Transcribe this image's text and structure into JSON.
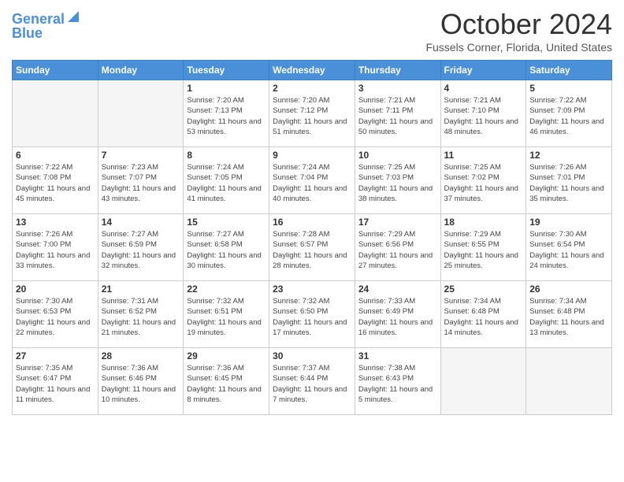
{
  "header": {
    "logo_line1": "General",
    "logo_line2": "Blue",
    "month_title": "October 2024",
    "location": "Fussels Corner, Florida, United States"
  },
  "days_of_week": [
    "Sunday",
    "Monday",
    "Tuesday",
    "Wednesday",
    "Thursday",
    "Friday",
    "Saturday"
  ],
  "weeks": [
    [
      {
        "day": "",
        "sunrise": "",
        "sunset": "",
        "daylight": ""
      },
      {
        "day": "",
        "sunrise": "",
        "sunset": "",
        "daylight": ""
      },
      {
        "day": "1",
        "sunrise": "Sunrise: 7:20 AM",
        "sunset": "Sunset: 7:13 PM",
        "daylight": "Daylight: 11 hours and 53 minutes."
      },
      {
        "day": "2",
        "sunrise": "Sunrise: 7:20 AM",
        "sunset": "Sunset: 7:12 PM",
        "daylight": "Daylight: 11 hours and 51 minutes."
      },
      {
        "day": "3",
        "sunrise": "Sunrise: 7:21 AM",
        "sunset": "Sunset: 7:11 PM",
        "daylight": "Daylight: 11 hours and 50 minutes."
      },
      {
        "day": "4",
        "sunrise": "Sunrise: 7:21 AM",
        "sunset": "Sunset: 7:10 PM",
        "daylight": "Daylight: 11 hours and 48 minutes."
      },
      {
        "day": "5",
        "sunrise": "Sunrise: 7:22 AM",
        "sunset": "Sunset: 7:09 PM",
        "daylight": "Daylight: 11 hours and 46 minutes."
      }
    ],
    [
      {
        "day": "6",
        "sunrise": "Sunrise: 7:22 AM",
        "sunset": "Sunset: 7:08 PM",
        "daylight": "Daylight: 11 hours and 45 minutes."
      },
      {
        "day": "7",
        "sunrise": "Sunrise: 7:23 AM",
        "sunset": "Sunset: 7:07 PM",
        "daylight": "Daylight: 11 hours and 43 minutes."
      },
      {
        "day": "8",
        "sunrise": "Sunrise: 7:24 AM",
        "sunset": "Sunset: 7:05 PM",
        "daylight": "Daylight: 11 hours and 41 minutes."
      },
      {
        "day": "9",
        "sunrise": "Sunrise: 7:24 AM",
        "sunset": "Sunset: 7:04 PM",
        "daylight": "Daylight: 11 hours and 40 minutes."
      },
      {
        "day": "10",
        "sunrise": "Sunrise: 7:25 AM",
        "sunset": "Sunset: 7:03 PM",
        "daylight": "Daylight: 11 hours and 38 minutes."
      },
      {
        "day": "11",
        "sunrise": "Sunrise: 7:25 AM",
        "sunset": "Sunset: 7:02 PM",
        "daylight": "Daylight: 11 hours and 37 minutes."
      },
      {
        "day": "12",
        "sunrise": "Sunrise: 7:26 AM",
        "sunset": "Sunset: 7:01 PM",
        "daylight": "Daylight: 11 hours and 35 minutes."
      }
    ],
    [
      {
        "day": "13",
        "sunrise": "Sunrise: 7:26 AM",
        "sunset": "Sunset: 7:00 PM",
        "daylight": "Daylight: 11 hours and 33 minutes."
      },
      {
        "day": "14",
        "sunrise": "Sunrise: 7:27 AM",
        "sunset": "Sunset: 6:59 PM",
        "daylight": "Daylight: 11 hours and 32 minutes."
      },
      {
        "day": "15",
        "sunrise": "Sunrise: 7:27 AM",
        "sunset": "Sunset: 6:58 PM",
        "daylight": "Daylight: 11 hours and 30 minutes."
      },
      {
        "day": "16",
        "sunrise": "Sunrise: 7:28 AM",
        "sunset": "Sunset: 6:57 PM",
        "daylight": "Daylight: 11 hours and 28 minutes."
      },
      {
        "day": "17",
        "sunrise": "Sunrise: 7:29 AM",
        "sunset": "Sunset: 6:56 PM",
        "daylight": "Daylight: 11 hours and 27 minutes."
      },
      {
        "day": "18",
        "sunrise": "Sunrise: 7:29 AM",
        "sunset": "Sunset: 6:55 PM",
        "daylight": "Daylight: 11 hours and 25 minutes."
      },
      {
        "day": "19",
        "sunrise": "Sunrise: 7:30 AM",
        "sunset": "Sunset: 6:54 PM",
        "daylight": "Daylight: 11 hours and 24 minutes."
      }
    ],
    [
      {
        "day": "20",
        "sunrise": "Sunrise: 7:30 AM",
        "sunset": "Sunset: 6:53 PM",
        "daylight": "Daylight: 11 hours and 22 minutes."
      },
      {
        "day": "21",
        "sunrise": "Sunrise: 7:31 AM",
        "sunset": "Sunset: 6:52 PM",
        "daylight": "Daylight: 11 hours and 21 minutes."
      },
      {
        "day": "22",
        "sunrise": "Sunrise: 7:32 AM",
        "sunset": "Sunset: 6:51 PM",
        "daylight": "Daylight: 11 hours and 19 minutes."
      },
      {
        "day": "23",
        "sunrise": "Sunrise: 7:32 AM",
        "sunset": "Sunset: 6:50 PM",
        "daylight": "Daylight: 11 hours and 17 minutes."
      },
      {
        "day": "24",
        "sunrise": "Sunrise: 7:33 AM",
        "sunset": "Sunset: 6:49 PM",
        "daylight": "Daylight: 11 hours and 16 minutes."
      },
      {
        "day": "25",
        "sunrise": "Sunrise: 7:34 AM",
        "sunset": "Sunset: 6:48 PM",
        "daylight": "Daylight: 11 hours and 14 minutes."
      },
      {
        "day": "26",
        "sunrise": "Sunrise: 7:34 AM",
        "sunset": "Sunset: 6:48 PM",
        "daylight": "Daylight: 11 hours and 13 minutes."
      }
    ],
    [
      {
        "day": "27",
        "sunrise": "Sunrise: 7:35 AM",
        "sunset": "Sunset: 6:47 PM",
        "daylight": "Daylight: 11 hours and 11 minutes."
      },
      {
        "day": "28",
        "sunrise": "Sunrise: 7:36 AM",
        "sunset": "Sunset: 6:46 PM",
        "daylight": "Daylight: 11 hours and 10 minutes."
      },
      {
        "day": "29",
        "sunrise": "Sunrise: 7:36 AM",
        "sunset": "Sunset: 6:45 PM",
        "daylight": "Daylight: 11 hours and 8 minutes."
      },
      {
        "day": "30",
        "sunrise": "Sunrise: 7:37 AM",
        "sunset": "Sunset: 6:44 PM",
        "daylight": "Daylight: 11 hours and 7 minutes."
      },
      {
        "day": "31",
        "sunrise": "Sunrise: 7:38 AM",
        "sunset": "Sunset: 6:43 PM",
        "daylight": "Daylight: 11 hours and 5 minutes."
      },
      {
        "day": "",
        "sunrise": "",
        "sunset": "",
        "daylight": ""
      },
      {
        "day": "",
        "sunrise": "",
        "sunset": "",
        "daylight": ""
      }
    ]
  ]
}
